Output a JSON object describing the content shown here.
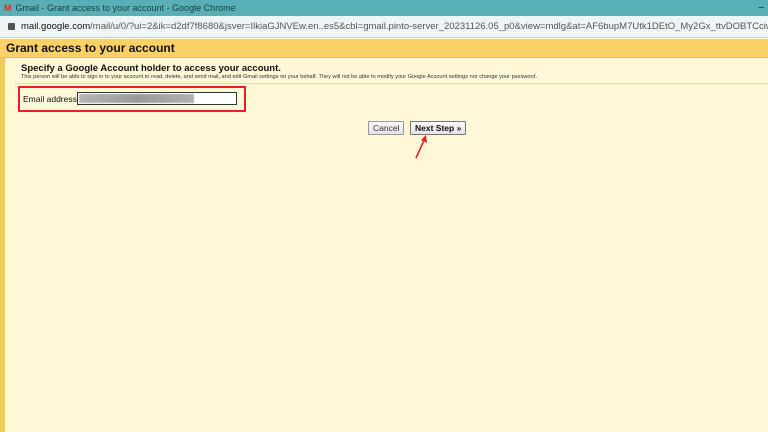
{
  "window": {
    "title": "Gmail - Grant access to your account - Google Chrome",
    "favicon": "gmail-icon",
    "minimize": "–"
  },
  "address_bar": {
    "host": "mail.google.com",
    "path": "/mail/u/0/?ui=2&ik=d2df7f8680&jsver=IlkiaGJNVEw.en..es5&cbl=gmail.pinto-server_20231126.05_p0&view=mdlg&at=AF6bupM7Utk1DEtO_My2Gx_ttvDOBTCciw"
  },
  "page": {
    "header": "Grant access to your account",
    "heading": "Specify a Google Account holder to access your account.",
    "description": "This person will be able to sign in to your account to read, delete, and send mail, and edit Gmail settings on your behalf. They will not be able to modify your Google Account settings nor change your password.",
    "email_label": "Email address:",
    "email_value_blurred": true,
    "cancel_label": "Cancel",
    "next_label": "Next Step »",
    "highlight_color": "#e8202a"
  }
}
